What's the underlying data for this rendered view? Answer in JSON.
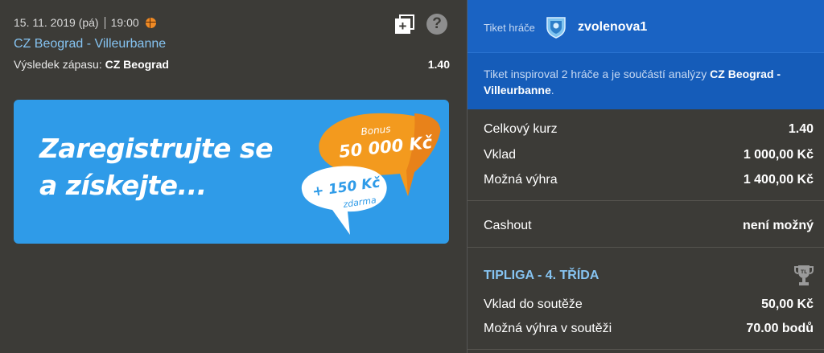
{
  "event": {
    "date": "15. 11. 2019 (pá)",
    "time": "19:00",
    "sport_icon": "basketball-icon",
    "match": "CZ Beograd - Villeurbanne",
    "result_label": "Výsledek zápasu:",
    "result_pick": "CZ Beograd",
    "odds": "1.40"
  },
  "actions": {
    "copy_icon": "copy-ticket-icon",
    "copy_glyph": "+",
    "help_icon": "help-icon",
    "help_glyph": "?"
  },
  "banner": {
    "line1": "Zaregistrujte se",
    "line2": "a získejte...",
    "bonus_label": "Bonus",
    "bonus_amount": "50 000 Kč",
    "free_amount": "+ 150 Kč",
    "free_label": "zdarma",
    "colors": {
      "background": "#2f9be8",
      "bonus_bubble": "#f39a1e",
      "free_bubble": "#ffffff"
    }
  },
  "ticket": {
    "header_label": "Tiket hráče",
    "player": "zvolenova1",
    "info_text": "Tiket inspiroval 2 hráče a je součástí analýzy ",
    "info_match": "CZ Beograd - Villeurbanne",
    "info_end": ".",
    "rows": [
      {
        "label": "Celkový kurz",
        "value": "1.40"
      },
      {
        "label": "Vklad",
        "value": "1 000,00 Kč"
      },
      {
        "label": "Možná výhra",
        "value": "1 400,00 Kč"
      }
    ],
    "cashout": {
      "label": "Cashout",
      "value": "není možný"
    },
    "league": {
      "title": "TIPLIGA - 4. TŘÍDA",
      "icon": "trophy-icon",
      "rows": [
        {
          "label": "Vklad do soutěže",
          "value": "50,00 Kč"
        },
        {
          "label": "Možná výhra v soutěži",
          "value": "70.00 bodů"
        }
      ]
    }
  },
  "colors": {
    "accent_link": "#86c4f2",
    "header_blue": "#1a63c3",
    "panel_bg": "#3c3b37"
  }
}
